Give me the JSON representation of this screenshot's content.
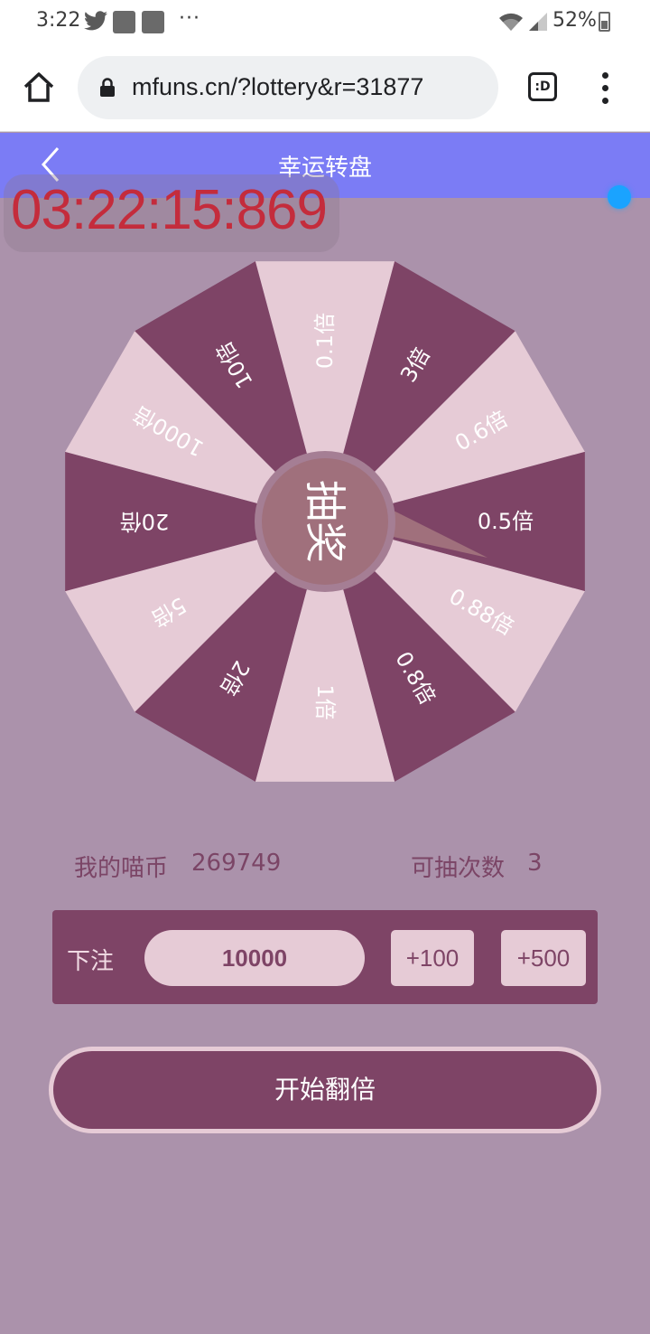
{
  "status_bar": {
    "time": "3:22",
    "overflow_dots": "···",
    "battery": "52%",
    "icons": [
      "twitter-icon",
      "notification-icon",
      "notification-icon",
      "wifi-icon",
      "signal-icon",
      "battery-icon"
    ]
  },
  "browser": {
    "url": "mfuns.cn/?lottery&r=31877",
    "tabs_label": ":D"
  },
  "header": {
    "title": "幸运转盘"
  },
  "timer": "03:22:15:869",
  "wheel": {
    "center_label": "抽奖",
    "pointer_direction": "right",
    "colors": {
      "dark": "#7e4466",
      "light": "#e6cbd6",
      "hub": "#a0707c",
      "hub_ring": "#a57e94"
    },
    "segments": [
      "0.1倍",
      "3倍",
      "0.6倍",
      "0.5倍",
      "0.88倍",
      "0.8倍",
      "1倍",
      "2倍",
      "5倍",
      "20倍",
      "1000倍",
      "10倍"
    ]
  },
  "stats": {
    "coins_label": "我的喵币",
    "coins_value": "269749",
    "draws_label": "可抽次数",
    "draws_value": "3"
  },
  "bet": {
    "label": "下注",
    "amount": "10000",
    "add_100": "+100",
    "add_500": "+500"
  },
  "start_button": "开始翻倍",
  "accent_colors": {
    "header": "#7b7cf5",
    "page_bg": "#ab92ab",
    "timer_text": "#c42c3c"
  }
}
